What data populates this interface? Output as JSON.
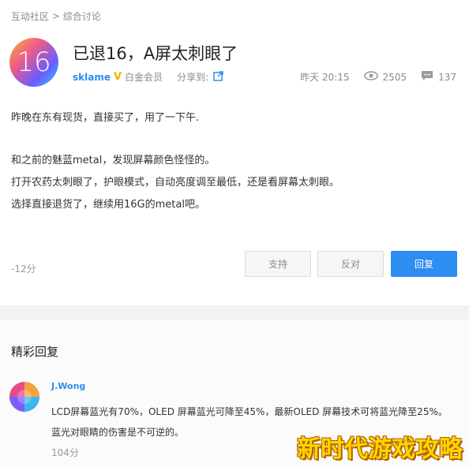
{
  "breadcrumb": {
    "item1": "互动社区",
    "sep": ">",
    "item2": "综合讨论"
  },
  "post": {
    "avatar_text": "16",
    "title": "已退16，A屏太刺眼了",
    "author": "sklame",
    "verified_badge": "V",
    "level": "白金会员",
    "share_label": "分享到:",
    "time": "昨天 20:15",
    "views": "2505",
    "comments": "137",
    "lines": [
      "昨晚在东有现货，直接买了，用了一下午.",
      "和之前的魅蓝metal，发现屏幕颜色怪怪的。",
      "打开农药太刺眼了，护眼模式，自动亮度调至最低，还是看屏幕太刺眼。",
      "选择直接退货了，继续用16G的metal吧。"
    ],
    "score": "-12分"
  },
  "actions": {
    "support": "支持",
    "oppose": "反对",
    "reply": "回复"
  },
  "replies_section": {
    "title": "精彩回复",
    "reply": {
      "author": "J.Wong",
      "text": "LCD屏幕蓝光有70%，OLED 屏幕蓝光可降至45%，最新OLED 屏幕技术可将蓝光降至25%。 蓝光对眼睛的伤害是不可逆的。",
      "score": "104分"
    }
  },
  "watermark": "新时代游戏攻略",
  "colors": {
    "accent": "#2e8df0",
    "badge": "#f4b000"
  }
}
